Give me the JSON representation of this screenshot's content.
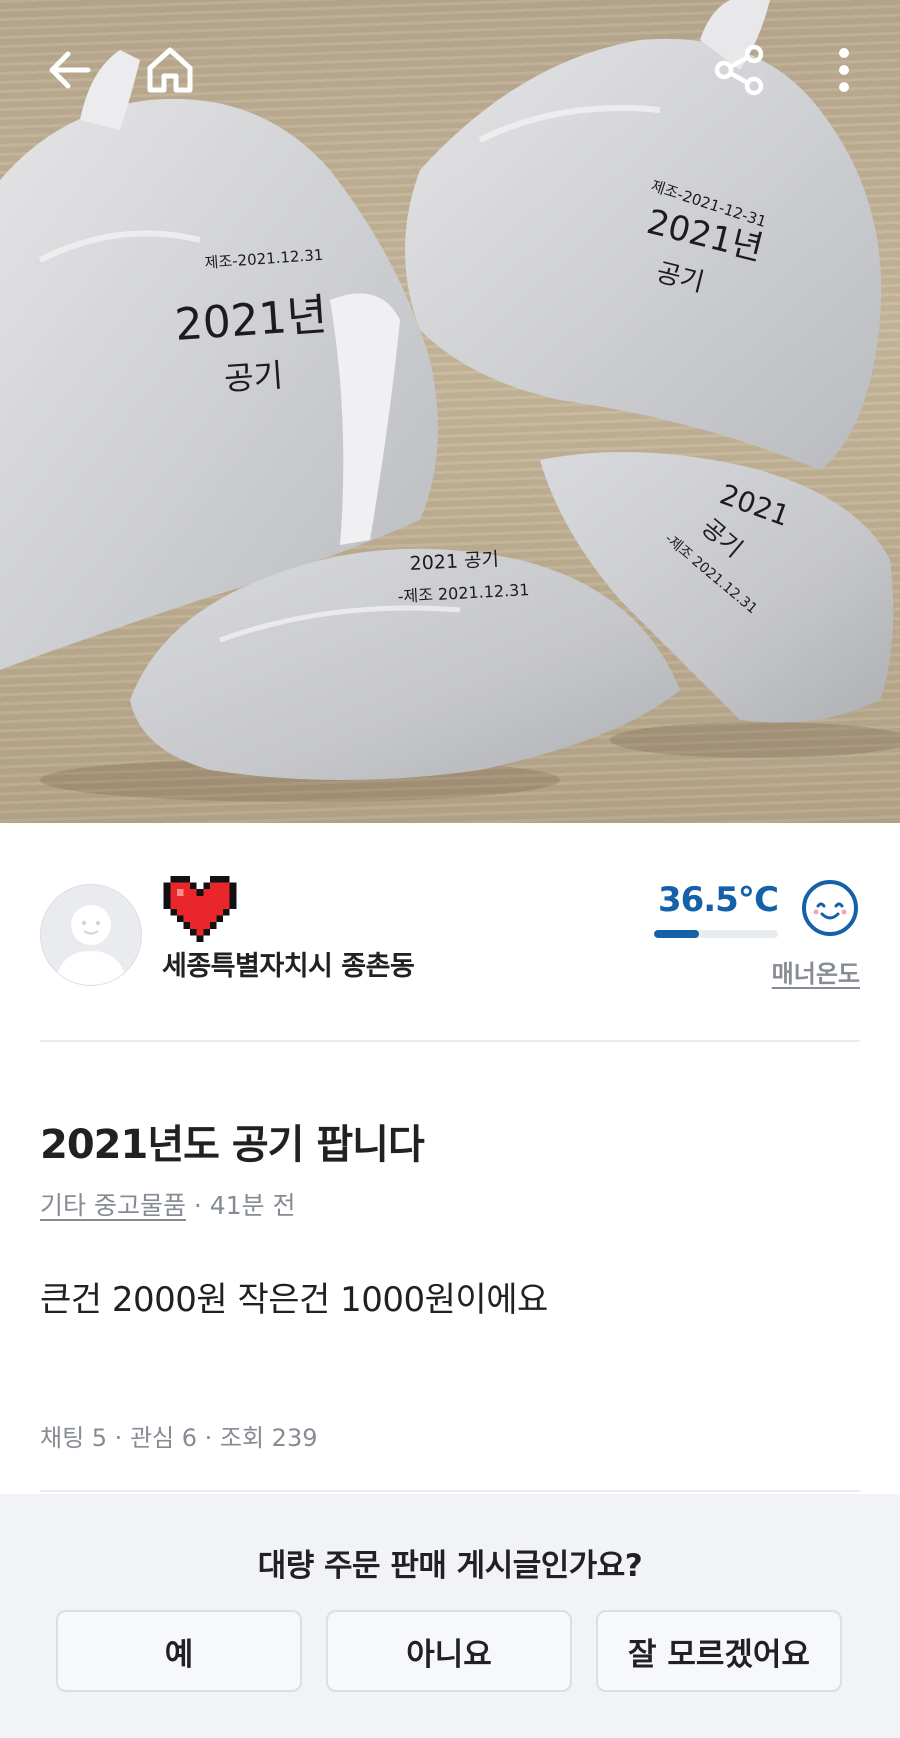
{
  "header": {
    "icons": [
      "back-arrow-icon",
      "home-icon",
      "share-icon",
      "more-vertical-icon"
    ]
  },
  "photo": {
    "bag_labels": {
      "bag1_small": "제조-2021.12.31",
      "bag1_main": "2021년",
      "bag1_sub": "공기",
      "bag2_small": "제조-2021-12-31",
      "bag2_main": "2021년",
      "bag2_sub": "공기",
      "bag3_line1": "2021 공기",
      "bag3_line2": "-제조 2021.12.31",
      "bag4_main": "2021",
      "bag4_sub": "공기",
      "bag4_small": "-제조 2021.12.31"
    }
  },
  "seller": {
    "location": "세종특별자치시 종촌동",
    "manner_temp": "36.5℃",
    "manner_temp_level": 0.365,
    "manner_label": "매너온도"
  },
  "article": {
    "title": "2021년도 공기 팝니다",
    "category": "기타 중고물품",
    "time": " · 41분 전",
    "content": "큰건 2000원 작은건 1000원이에요",
    "stats": "채팅 5 · 관심 6 · 조회 239"
  },
  "survey": {
    "question": "대량 주문 판매 게시글인가요?",
    "yes": "예",
    "no": "아니요",
    "unsure": "잘 모르겠어요"
  },
  "colors": {
    "accent_blue": "#1561a9",
    "text_primary": "#212124",
    "text_secondary": "#868b94",
    "panel_bg": "#f2f3f6"
  }
}
